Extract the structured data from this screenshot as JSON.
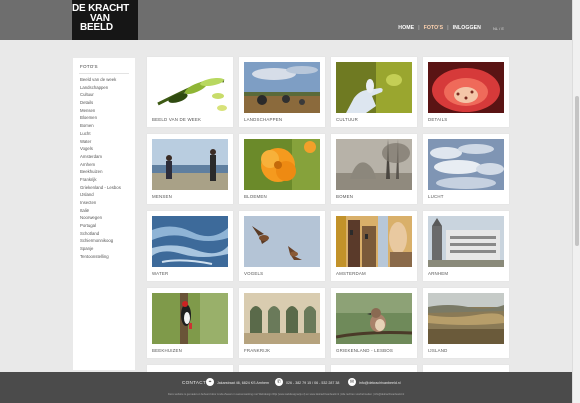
{
  "brand": {
    "line1": "DE KRACHT",
    "line2": "VAN",
    "line3": "BEELD"
  },
  "nav": {
    "home": "HOME",
    "photos": "FOTO'S",
    "login": "INLOGGEN",
    "lang": "NL / E"
  },
  "sidebar": {
    "title": "FOTO'S",
    "items": [
      "Beeld van de week",
      "Landschappen",
      "Cultuur",
      "Details",
      "Mensen",
      "Bloemen",
      "Bomen",
      "Lucht",
      "Water",
      "Vogels",
      "Amsterdam",
      "Arnhem",
      "Beekhuizen",
      "Frankrijk",
      "Griekenland - Lesbos",
      "IJsland",
      "Insecten",
      "Italië",
      "Noorwegen",
      "Portugal",
      "Schotland",
      "Schiermonnikoog",
      "Spanje",
      "Tentoonstelling"
    ]
  },
  "gallery": [
    {
      "caption": "BEELD VAN DE WEEK",
      "icon": "fern-leaf"
    },
    {
      "caption": "LANDSCHAPPEN",
      "icon": "hay-bales-landscape"
    },
    {
      "caption": "CULTUUR",
      "icon": "hand-sculpture"
    },
    {
      "caption": "DETAILS",
      "icon": "red-flower-detail"
    },
    {
      "caption": "MENSEN",
      "icon": "people-photographers"
    },
    {
      "caption": "BLOEMEN",
      "icon": "orange-poppy"
    },
    {
      "caption": "BOMEN",
      "icon": "misty-trees"
    },
    {
      "caption": "LUCHT",
      "icon": "clouds-sky"
    },
    {
      "caption": "WATER",
      "icon": "water-reflection"
    },
    {
      "caption": "VOGELS",
      "icon": "birds-of-prey"
    },
    {
      "caption": "AMSTERDAM",
      "icon": "amsterdam-street"
    },
    {
      "caption": "ARNHEM",
      "icon": "arnhem-building"
    },
    {
      "caption": "BEEKHUIZEN",
      "icon": "woodpecker"
    },
    {
      "caption": "FRANKRIJK",
      "icon": "cloister-arches"
    },
    {
      "caption": "GRIEKENLAND - LESBOS",
      "icon": "small-bird"
    },
    {
      "caption": "IJSLAND",
      "icon": "iceland-landscape"
    }
  ],
  "footer": {
    "contact": "CONTACT",
    "address": "Jakarstraat 46, 6824 KS Arnhem",
    "phone": "026 - 382 79 15 / 06 - 532 287 38",
    "email": "info@dekrachtvanbeeld.nl",
    "legal": "Deze website is gemaakt en beheerd door Linda Zweers in samenwerking met Webdesign Wijs (www.webdesignwijs.nl) en www.dekrachtvanbeeld.nl  |  Alle rechten voorbehouden  |  info@dekrachtvanbeeld.nl"
  },
  "colors": {
    "header": "#6e6e6e",
    "logo_bg": "#161616",
    "footer": "#4b4b4b",
    "page_bg": "#e9e9e9"
  }
}
